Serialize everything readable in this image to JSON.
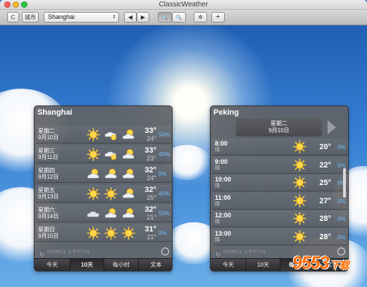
{
  "app_title": "ClassicWeather",
  "toolbar": {
    "refresh_label": "C",
    "city_label": "城市",
    "selected_city": "Shanghai",
    "back_label": "◀",
    "forward_label": "▶",
    "zoom_out_label": "🔍",
    "zoom_in_label": "🔍",
    "settings_label": "✲",
    "add_label": "+"
  },
  "left_panel": {
    "title": "Shanghai",
    "days": [
      {
        "weekday": "星期二",
        "date": "9月10日",
        "icons": [
          "sun",
          "sun-cloud",
          "cloud-sun"
        ],
        "high": "33°",
        "low": "24°",
        "pct": "50%"
      },
      {
        "weekday": "星期三",
        "date": "9月11日",
        "icons": [
          "sun",
          "sun-cloud",
          "cloud-sun"
        ],
        "high": "33°",
        "low": "23°",
        "pct": "40%"
      },
      {
        "weekday": "星期四",
        "date": "9月12日",
        "icons": [
          "cloud-sun",
          "cloud-sun",
          "cloud-sun"
        ],
        "high": "32°",
        "low": "24°",
        "pct": "0%"
      },
      {
        "weekday": "星期五",
        "date": "9月13日",
        "icons": [
          "sun",
          "sun",
          "cloud-sun"
        ],
        "high": "32°",
        "low": "25°",
        "pct": "40%"
      },
      {
        "weekday": "星期六",
        "date": "9月14日",
        "icons": [
          "cloud",
          "cloud-sun",
          "cloud-sun"
        ],
        "high": "32°",
        "low": "21°",
        "pct": "50%"
      },
      {
        "weekday": "星期日",
        "date": "9月15日",
        "icons": [
          "sun",
          "sun",
          "sun"
        ],
        "high": "31°",
        "low": "21°",
        "pct": "0%"
      }
    ],
    "status": "10/09/13 上午07:24",
    "tabs": [
      "今天",
      "10天",
      "每小时",
      "文本"
    ],
    "selected_tab": "10天"
  },
  "right_panel": {
    "title": "Peking",
    "header_weekday": "星期二",
    "header_date": "9月10日",
    "hours": [
      {
        "time": "8:00",
        "cond": "晴",
        "temp": "20°",
        "pct": "0%"
      },
      {
        "time": "9:00",
        "cond": "晴",
        "temp": "22°",
        "pct": "0%"
      },
      {
        "time": "10:00",
        "cond": "晴",
        "temp": "25°",
        "pct": "0%"
      },
      {
        "time": "11:00",
        "cond": "晴",
        "temp": "27°",
        "pct": "0%"
      },
      {
        "time": "12:00",
        "cond": "晴",
        "temp": "28°",
        "pct": "0%"
      },
      {
        "time": "13:00",
        "cond": "晴",
        "temp": "28°",
        "pct": "0%"
      }
    ],
    "status": "10/09/13 上午07:24",
    "tabs": [
      "今天",
      "10天",
      "每小时",
      "文本"
    ],
    "selected_tab": "每小时"
  },
  "watermark": {
    "main": "9553",
    "sub": "下载"
  },
  "colors": {
    "pct": "#6fbfff",
    "panel": "#606266",
    "watermark": "#ff6a00"
  }
}
